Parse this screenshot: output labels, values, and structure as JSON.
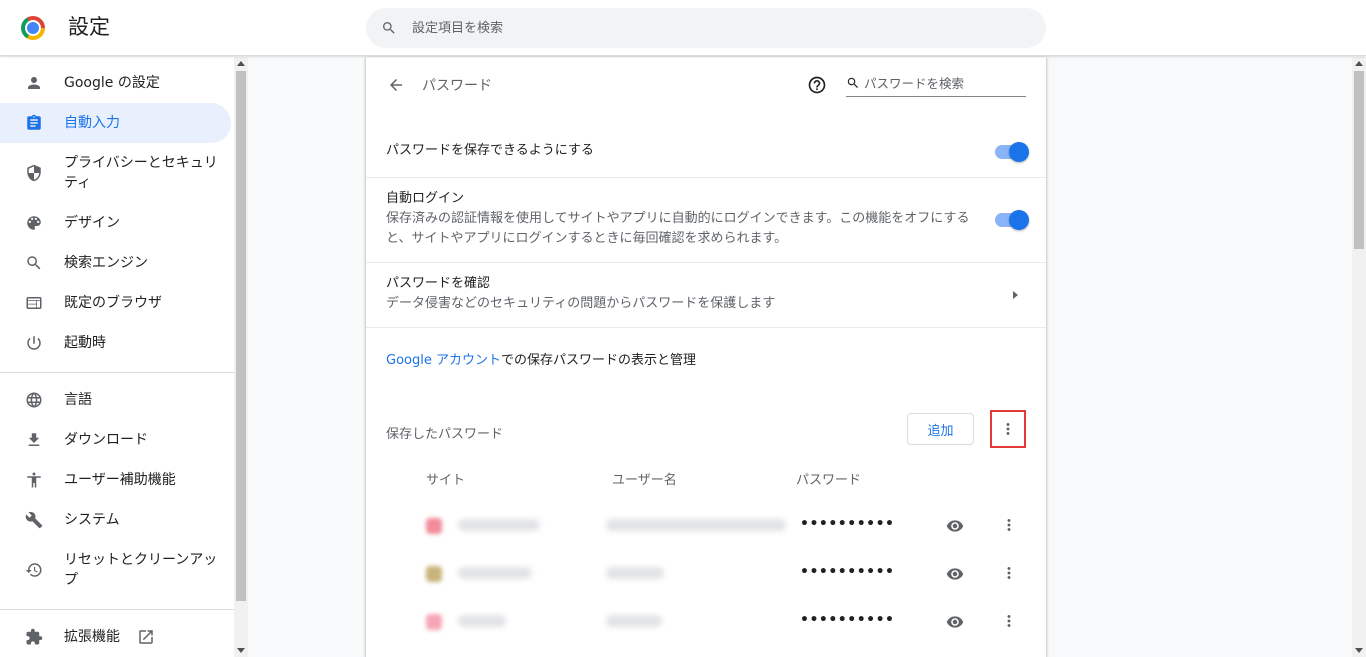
{
  "app": {
    "title": "設定"
  },
  "search": {
    "placeholder": "設定項目を検索"
  },
  "sidebar": {
    "items": [
      {
        "label": "Google の設定",
        "icon": "person-icon"
      },
      {
        "label": "自動入力",
        "icon": "clipboard-icon",
        "active": true
      },
      {
        "label": "プライバシーとセキュリティ",
        "icon": "shield-icon"
      },
      {
        "label": "デザイン",
        "icon": "palette-icon"
      },
      {
        "label": "検索エンジン",
        "icon": "search-icon"
      },
      {
        "label": "既定のブラウザ",
        "icon": "browser-icon"
      },
      {
        "label": "起動時",
        "icon": "power-icon"
      },
      {
        "label": "言語",
        "icon": "globe-icon"
      },
      {
        "label": "ダウンロード",
        "icon": "download-icon"
      },
      {
        "label": "ユーザー補助機能",
        "icon": "accessibility-icon"
      },
      {
        "label": "システム",
        "icon": "wrench-icon"
      },
      {
        "label": "リセットとクリーンアップ",
        "icon": "restore-icon"
      },
      {
        "label": "拡張機能",
        "icon": "puzzle-icon"
      }
    ]
  },
  "main": {
    "page_title": "パスワード",
    "password_search_placeholder": "パスワードを検索",
    "offer_to_save": {
      "label": "パスワードを保存できるようにする",
      "enabled": true
    },
    "auto_signin": {
      "label": "自動ログイン",
      "description": "保存済みの認証情報を使用してサイトやアプリに自動的にログインできます。この機能をオフにすると、サイトやアプリにログインするときに毎回確認を求められます。",
      "enabled": true
    },
    "check_passwords": {
      "label": "パスワードを確認",
      "description": "データ侵害などのセキュリティの問題からパスワードを保護します"
    },
    "google_account": {
      "link": "Google アカウント",
      "text": "での保存パスワードの表示と管理"
    },
    "saved": {
      "label": "保存したパスワード",
      "add_label": "追加",
      "columns": [
        "サイト",
        "ユーザー名",
        "パスワード"
      ],
      "rows": [
        {
          "password": "••••••••••",
          "favicon_color": "#f28b9a"
        },
        {
          "password": "••••••••••",
          "favicon_color": "#c8b37a"
        },
        {
          "password": "••••••••••",
          "favicon_color": "#f6a5b4"
        }
      ]
    }
  },
  "colors": {
    "accent": "#1a73e8",
    "highlight_border": "#e53935"
  }
}
